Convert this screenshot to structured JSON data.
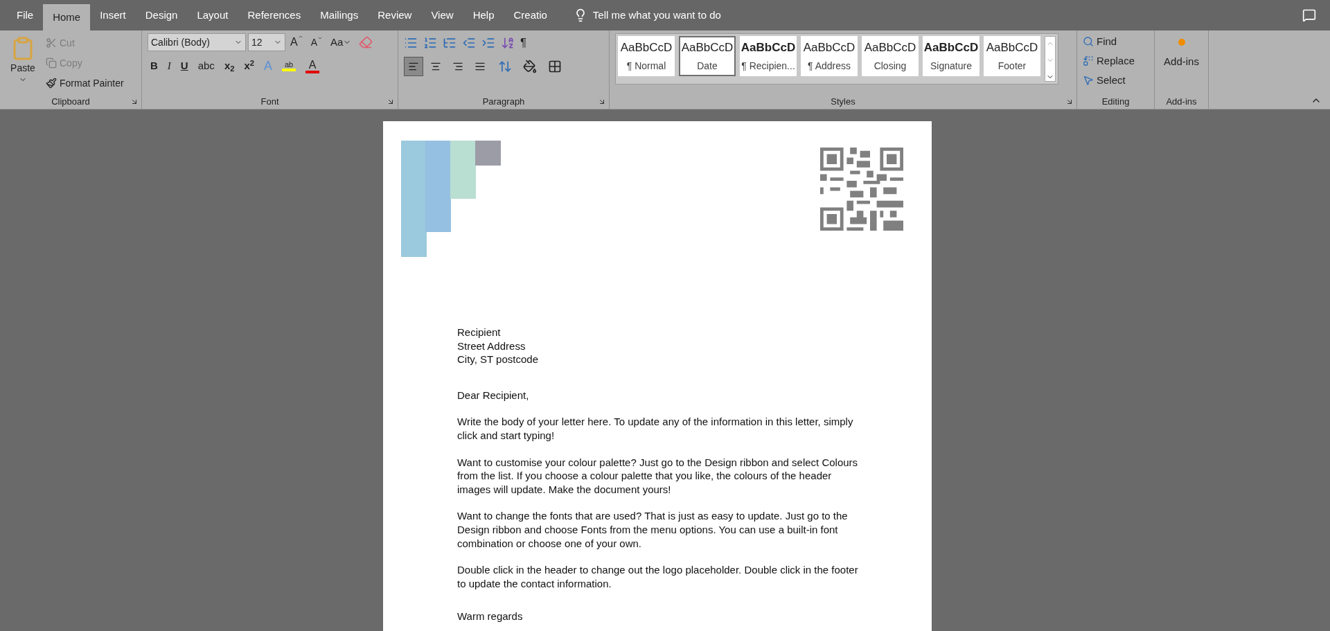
{
  "tabs": [
    {
      "label": "File",
      "selected": false
    },
    {
      "label": "Home",
      "selected": true
    },
    {
      "label": "Insert",
      "selected": false
    },
    {
      "label": "Design",
      "selected": false
    },
    {
      "label": "Layout",
      "selected": false
    },
    {
      "label": "References",
      "selected": false
    },
    {
      "label": "Mailings",
      "selected": false
    },
    {
      "label": "Review",
      "selected": false
    },
    {
      "label": "View",
      "selected": false
    },
    {
      "label": "Help",
      "selected": false
    },
    {
      "label": "Creatio",
      "selected": false
    }
  ],
  "tell_me": {
    "placeholder": "Tell me what you want to do"
  },
  "clipboard": {
    "group": "Clipboard",
    "paste": "Paste",
    "items": [
      {
        "kind": "cut",
        "label": "Cut",
        "disabled": true
      },
      {
        "kind": "copy",
        "label": "Copy",
        "disabled": true
      },
      {
        "kind": "painter",
        "label": "Format Painter",
        "disabled": false
      }
    ]
  },
  "font": {
    "group": "Font",
    "name": "Calibri (Body)",
    "size": "12",
    "case": "Aa",
    "grow": "A",
    "shrink": "A",
    "formats": [
      {
        "kind": "bold",
        "label": "B"
      },
      {
        "kind": "italic",
        "label": "I"
      },
      {
        "kind": "underline",
        "label": "U"
      },
      {
        "kind": "strike",
        "label": "abc"
      },
      {
        "kind": "plain",
        "label": "x$_{2}$"
      },
      {
        "kind": "plain",
        "label": "x$^{2}$"
      }
    ],
    "effects": "A",
    "highlight": "ab",
    "font_color": "A"
  },
  "paragraph": {
    "group": "Paragraph",
    "marks": "¶",
    "align": [
      {
        "kind": "left",
        "selected": true
      },
      {
        "kind": "center",
        "selected": false
      },
      {
        "kind": "right",
        "selected": false
      },
      {
        "kind": "justify",
        "selected": false
      }
    ]
  },
  "styles": {
    "group": "Styles",
    "items": [
      {
        "preview": "AaBbCcD",
        "name": "¶ Normal",
        "selected": false,
        "bold": false
      },
      {
        "preview": "AaBbCcD",
        "name": "Date",
        "selected": true,
        "bold": false
      },
      {
        "preview": "AaBbCcD",
        "name": "¶ Recipien...",
        "selected": false,
        "bold": true
      },
      {
        "preview": "AaBbCcD",
        "name": "¶ Address",
        "selected": false,
        "bold": false
      },
      {
        "preview": "AaBbCcD",
        "name": "Closing",
        "selected": false,
        "bold": false
      },
      {
        "preview": "AaBbCcD",
        "name": "Signature",
        "selected": false,
        "bold": true
      },
      {
        "preview": "AaBbCcD",
        "name": "Footer",
        "selected": false,
        "bold": false
      }
    ]
  },
  "editing": {
    "group": "Editing",
    "items": [
      {
        "kind": "find",
        "label": "Find"
      },
      {
        "kind": "replace",
        "label": "Replace"
      },
      {
        "kind": "select",
        "label": "Select"
      }
    ]
  },
  "addins": {
    "group": "Add-ins",
    "label": "Add-ins"
  },
  "document": {
    "address": [
      "Recipient",
      "Street Address",
      "City, ST postcode"
    ],
    "salutation": "Dear Recipient,",
    "paragraphs": [
      "Write the body of your letter here. To update any of the information in this letter, simply click and start typing!",
      "Want to customise your colour palette? Just go to the Design ribbon and select Colours from the list. If you choose a colour palette that you like, the colours of the header images will update. Make the document yours!",
      "Want to change the fonts that are used? That is just as easy to update. Just go to the Design ribbon and choose Fonts from the menu options. You can use a built-in font combination or choose one of your own.",
      "Double click in the header to change out the logo placeholder. Double click in the footer to update the contact information."
    ],
    "closing": "Warm regards"
  }
}
